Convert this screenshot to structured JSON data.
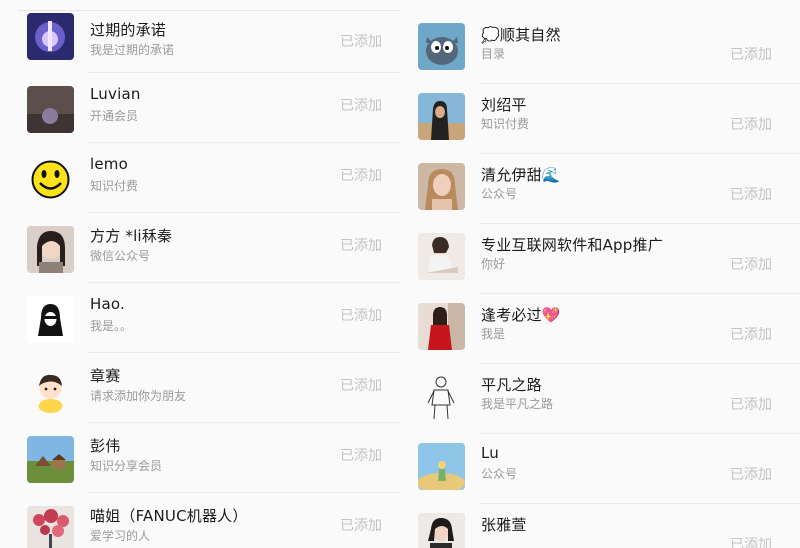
{
  "left_contacts": [
    {
      "name": "过期的承诺",
      "subtitle": "我是过期的承诺",
      "status": "已添加",
      "avatar": "night-city-photo"
    },
    {
      "name": "Luvian",
      "subtitle": "开通会员",
      "status": "已添加",
      "avatar": "dark-landscape-photo"
    },
    {
      "name": "lemo",
      "subtitle": "知识付费",
      "status": "已添加",
      "avatar": "smiley-face"
    },
    {
      "name": "方方 *li秝秦",
      "subtitle": "微信公众号",
      "status": "已添加",
      "avatar": "woman-selfie-photo"
    },
    {
      "name": "Hao.",
      "subtitle": "我是。。",
      "status": "已添加",
      "avatar": "hooded-silhouette"
    },
    {
      "name": "章赛",
      "subtitle": "请求添加你为朋友",
      "status": "已添加",
      "avatar": "cartoon-child"
    },
    {
      "name": "彭伟",
      "subtitle": "知识分享会员",
      "status": "已添加",
      "avatar": "village-landscape-photo"
    },
    {
      "name": "喵姐（FANUC机器人）",
      "subtitle": "爱学习的人",
      "status": "已添加",
      "avatar": "flowers-photo"
    }
  ],
  "right_contacts": [
    {
      "name": "💭顺其自然",
      "subtitle": "目录",
      "status": "已添加",
      "avatar": "cartoon-cat"
    },
    {
      "name": "刘绍平",
      "subtitle": "知识付费",
      "status": "已添加",
      "avatar": "man-outdoor-photo"
    },
    {
      "name": "清允伊甜🌊",
      "subtitle": "公众号",
      "status": "已添加",
      "avatar": "woman-portrait-photo"
    },
    {
      "name": "专业互联网软件和App推广",
      "subtitle": "你好",
      "status": "已添加",
      "avatar": "woman-sitting-photo"
    },
    {
      "name": "逢考必过💖",
      "subtitle": "我是",
      "status": "已添加",
      "avatar": "woman-red-dress-photo"
    },
    {
      "name": "平凡之路",
      "subtitle": "我是平凡之路",
      "status": "已添加",
      "avatar": "sketch-man-drawing"
    },
    {
      "name": "Lu",
      "subtitle": "公众号",
      "status": "已添加",
      "avatar": "desert-figure-art"
    },
    {
      "name": "张雅萱",
      "subtitle": "",
      "status": "已添加",
      "avatar": "woman-portrait-photo"
    }
  ]
}
